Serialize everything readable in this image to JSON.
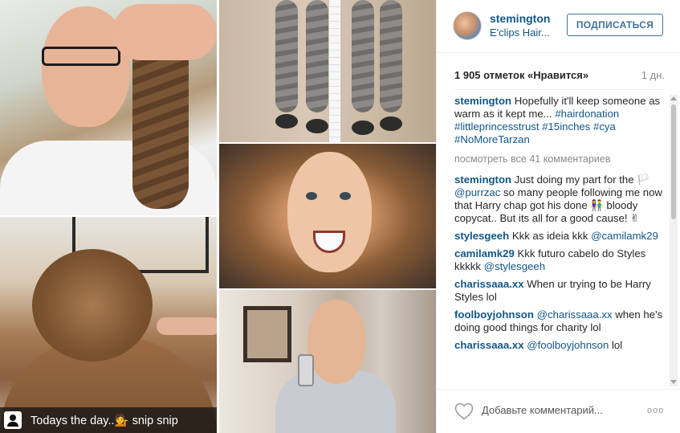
{
  "post": {
    "caption_overlay": "Todays the day..💁 snip snip"
  },
  "header": {
    "username": "stemington",
    "location": "E'clips Hair...",
    "follow_label": "ПОДПИСАТЬСЯ"
  },
  "stats": {
    "likes": "1 905 отметок «Нравится»",
    "time_ago": "1 дн."
  },
  "caption": {
    "user": "stemington",
    "text": "Hopefully it'll keep someone as warm as it kept me... ",
    "tags": "#hairdonation #littleprincesstrust #15inches #cya #NoMoreTarzan"
  },
  "view_all_comments": "посмотреть все 41 комментариев",
  "comments": [
    {
      "user": "stemington",
      "pre": "Just doing my part for the 🏳️ ",
      "mention": "@purrzac",
      "post": " so many people following me now that Harry chap got his done 👫 bloody copycat.. But its all for a good cause! ✌"
    },
    {
      "user": "stylesgeeh",
      "pre": "Kkk as ideia kkk ",
      "mention": "@camilamk29",
      "post": ""
    },
    {
      "user": "camilamk29",
      "pre": "Kkk futuro cabelo do Styles kkkkk ",
      "mention": "@stylesgeeh",
      "post": ""
    },
    {
      "user": "charissaaa.xx",
      "pre": "When ur trying to be Harry Styles lol",
      "mention": "",
      "post": ""
    },
    {
      "user": "foolboyjohnson",
      "pre": "",
      "mention": "@charissaaa.xx",
      "post": " when he's doing good things for charity lol"
    },
    {
      "user": "charissaaa.xx",
      "pre": "",
      "mention": "@foolboyjohnson",
      "post": " lol"
    }
  ],
  "footer": {
    "add_comment_placeholder": "Добавьте комментарий...",
    "more_label": "ooo"
  },
  "colors": {
    "link": "#125688",
    "follow_border": "#3f729b",
    "muted": "#8a8a8a"
  }
}
